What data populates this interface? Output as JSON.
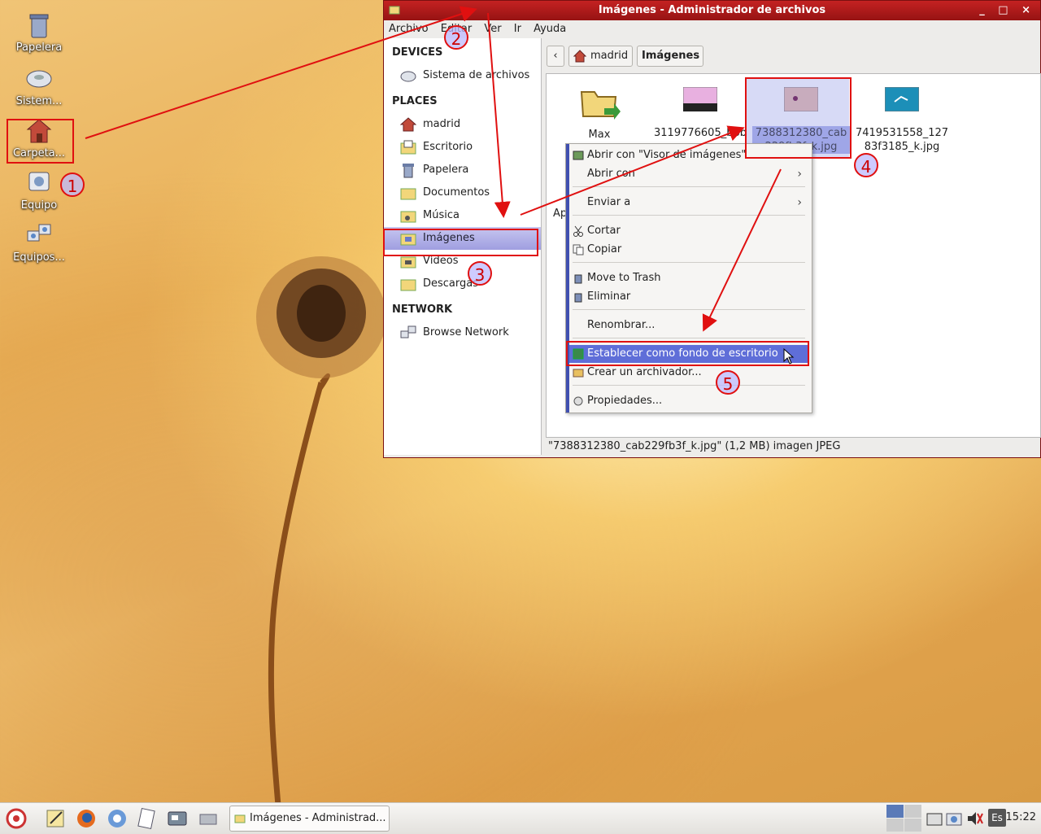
{
  "desktop": {
    "icons": [
      {
        "label": "Papelera"
      },
      {
        "label": "Sistem..."
      },
      {
        "label": "Carpeta..."
      },
      {
        "label": "Equipo"
      },
      {
        "label": "Equipos..."
      }
    ]
  },
  "annotations": [
    "1",
    "2",
    "3",
    "4",
    "5"
  ],
  "window": {
    "title": "Imágenes - Administrador de archivos",
    "controls": "_ □ ×",
    "menu": [
      "Archivo",
      "Editar",
      "Ver",
      "Ir",
      "Ayuda"
    ]
  },
  "sidebar": {
    "devices_heading": "DEVICES",
    "devices": [
      {
        "label": "Sistema de archivos",
        "icon": "drive-icon"
      }
    ],
    "places_heading": "PLACES",
    "places": [
      {
        "label": "madrid",
        "icon": "home-icon"
      },
      {
        "label": "Escritorio",
        "icon": "desktop-folder-icon"
      },
      {
        "label": "Papelera",
        "icon": "trash-icon"
      },
      {
        "label": "Documentos",
        "icon": "folder-icon"
      },
      {
        "label": "Música",
        "icon": "music-folder-icon"
      },
      {
        "label": "Imágenes",
        "icon": "pictures-folder-icon",
        "selected": true
      },
      {
        "label": "Vídeos",
        "icon": "video-folder-icon"
      },
      {
        "label": "Descargas",
        "icon": "folder-icon"
      }
    ],
    "network_heading": "NETWORK",
    "network": [
      {
        "label": "Browse Network",
        "icon": "network-icon"
      }
    ]
  },
  "pathbar": {
    "back": "‹",
    "crumbs": [
      "madrid",
      "Imágenes"
    ]
  },
  "files": [
    {
      "name_line1": "Max",
      "name_line2": ""
    },
    {
      "name_line1": "3119776605_bbb",
      "name_line2": ""
    },
    {
      "name_line1": "7388312380_cab",
      "name_line2": "229fb3f_k.jpg"
    },
    {
      "name_line1": "7419531558_127",
      "name_line2": "83f3185_k.jpg"
    }
  ],
  "partial_label": "Ap",
  "context_menu": {
    "items": [
      {
        "label": "Abrir con \"Visor de imágenes\"",
        "icon": "image-viewer-icon"
      },
      {
        "label": "Abrir con",
        "submenu": true
      },
      {
        "label": "Enviar a",
        "submenu": true
      },
      {
        "label": "Cortar",
        "icon": "scissors-icon"
      },
      {
        "label": "Copiar",
        "icon": "copy-icon"
      },
      {
        "label": "Move to Trash",
        "icon": "trash-icon"
      },
      {
        "label": "Eliminar",
        "icon": "trash-icon"
      },
      {
        "label": "Renombrar..."
      },
      {
        "label": "Establecer como fondo de escritorio",
        "icon": "wallpaper-icon",
        "highlighted": true
      },
      {
        "label": "Crear un archivador...",
        "icon": "archive-icon"
      },
      {
        "label": "Propiedades...",
        "icon": "properties-icon"
      }
    ],
    "submenu_arrow": "›"
  },
  "statusbar": {
    "text": "\"7388312380_cab229fb3f_k.jpg\" (1,2 MB) imagen JPEG"
  },
  "taskbar": {
    "task_label": "Imágenes - Administrad...",
    "keyboard": "Es",
    "clock": "15:22"
  },
  "colors": {
    "annotation_red": "#e01010",
    "selection": "#5f6ed8",
    "titlebar": "#b01a1a"
  }
}
